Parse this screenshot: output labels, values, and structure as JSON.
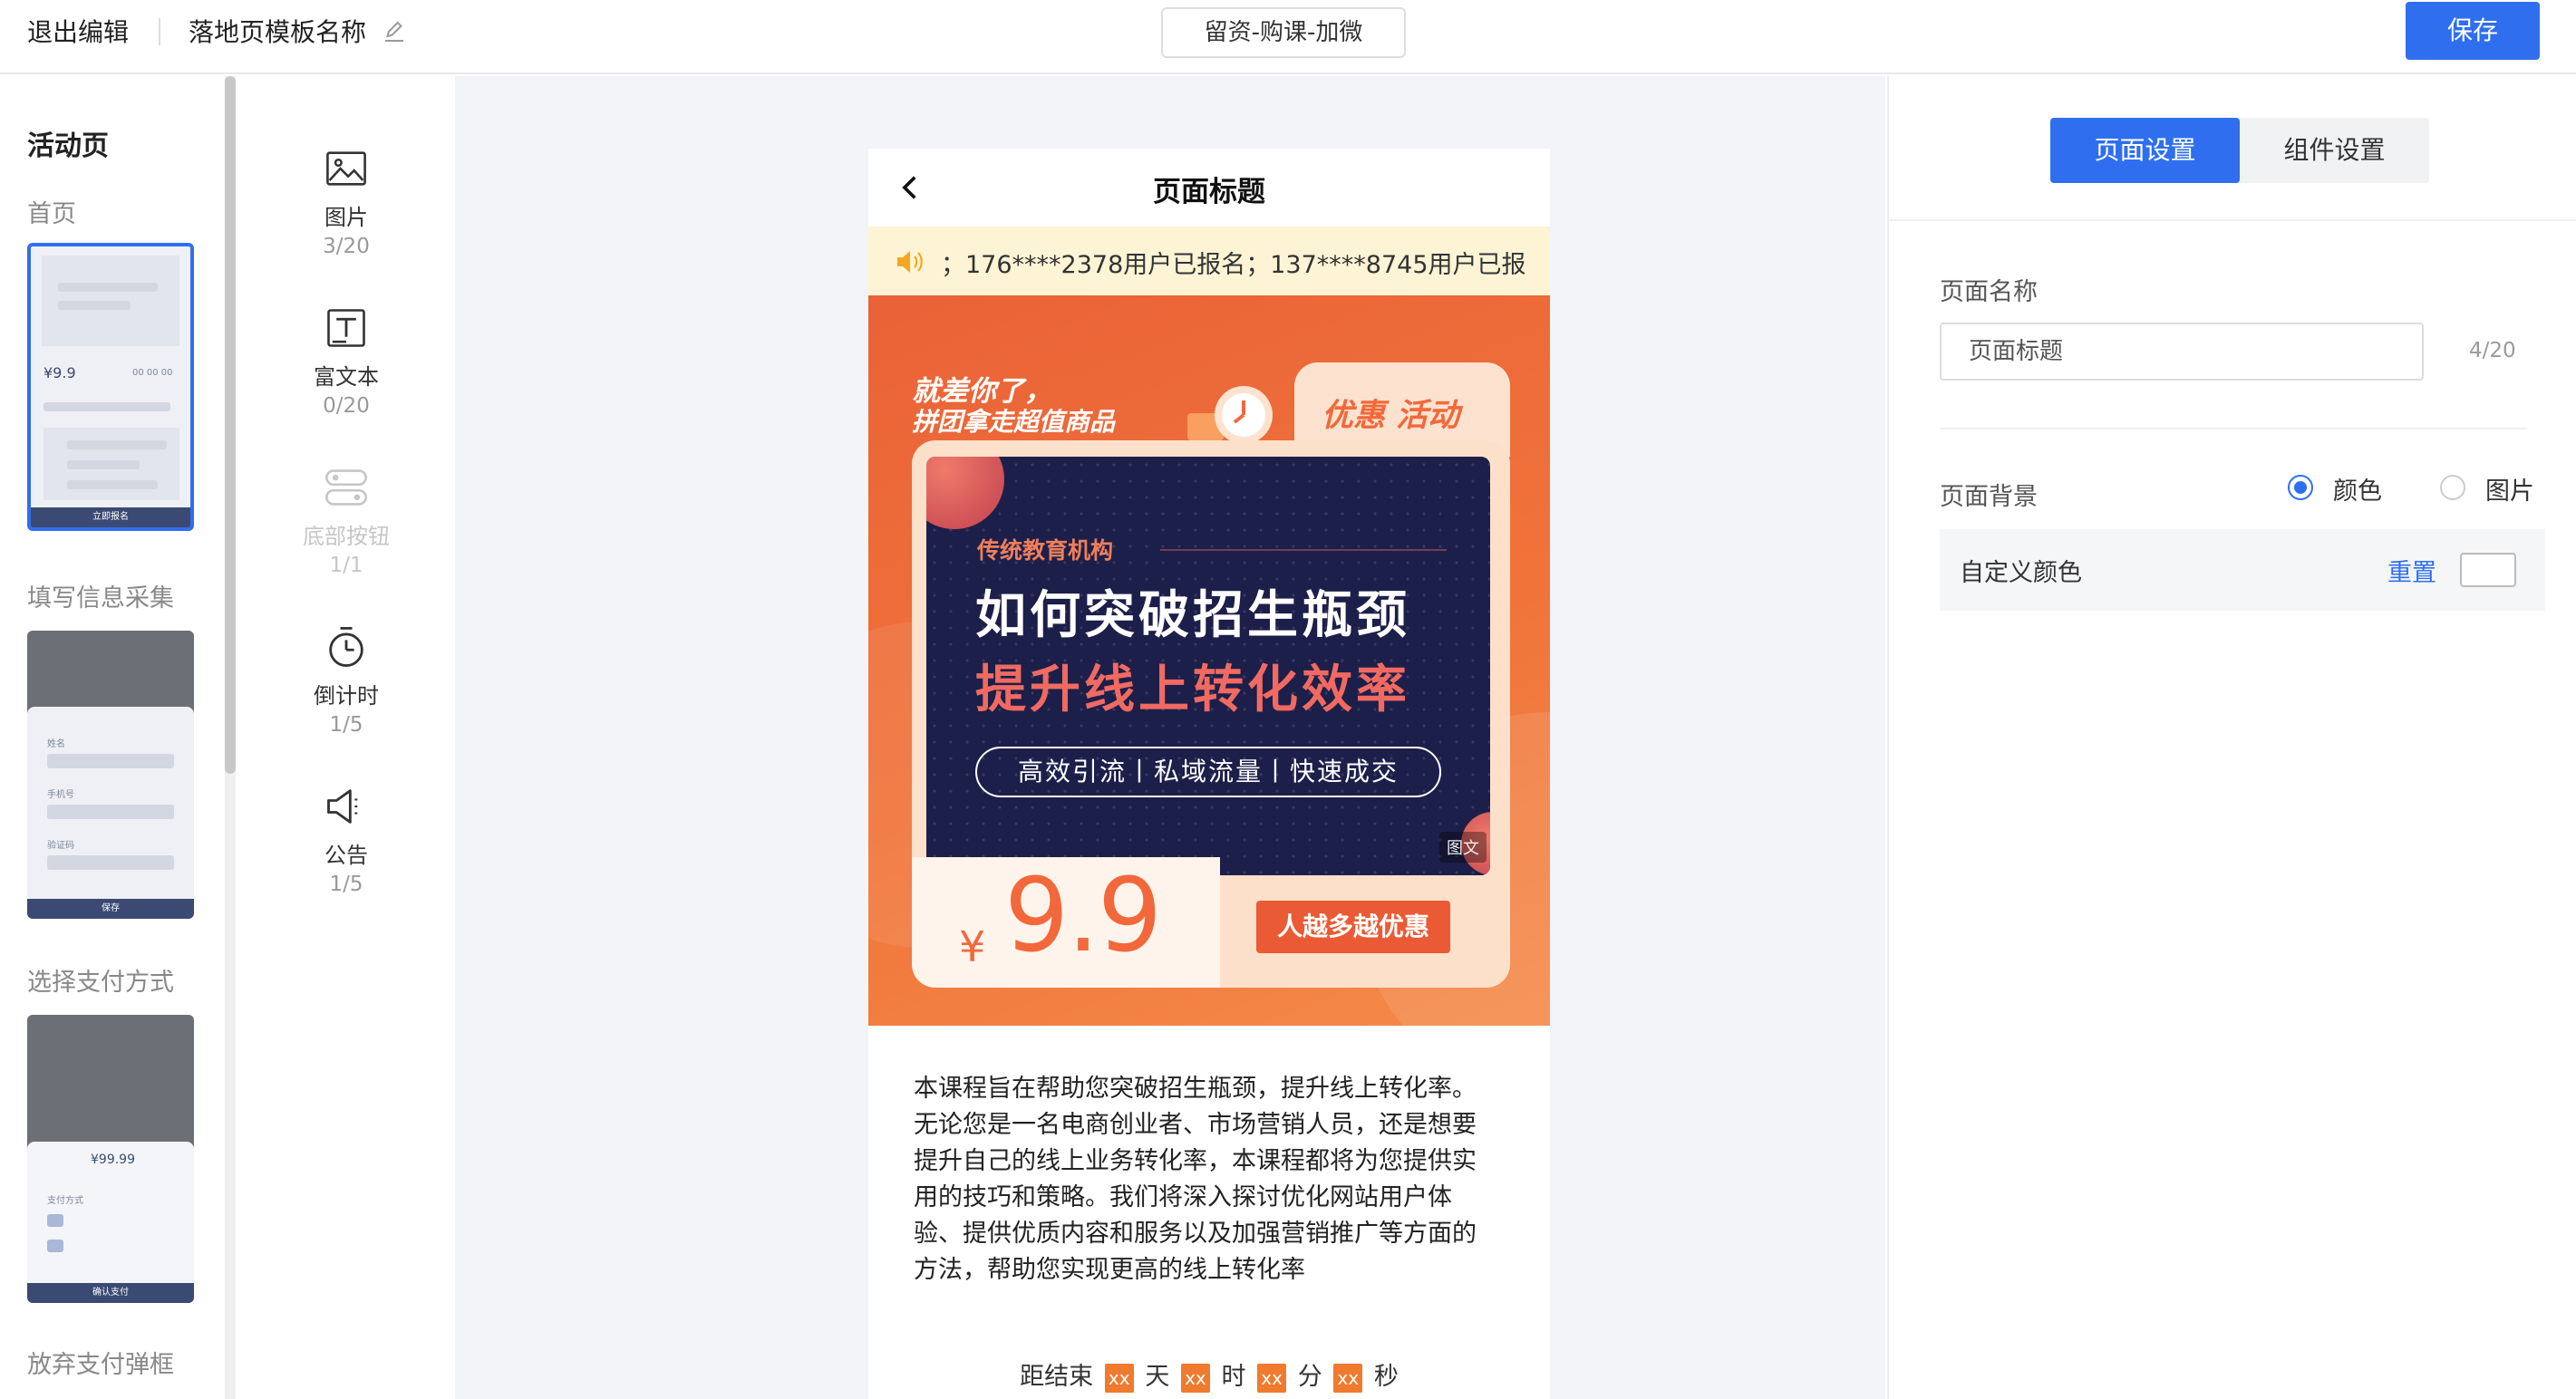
{
  "topbar": {
    "exit_label": "退出编辑",
    "template_name": "落地页模板名称",
    "mode_label": "留资-购课-加微",
    "save_label": "保存"
  },
  "pages": {
    "title": "活动页",
    "items": [
      {
        "label": "首页",
        "preview_price": "¥9.9",
        "preview_timer": "00 00 00",
        "preview_button": "立即报名"
      },
      {
        "label": "填写信息采集",
        "preview_fields": [
          "姓名",
          "手机号",
          "验证码"
        ],
        "preview_button": "保存"
      },
      {
        "label": "选择支付方式",
        "preview_price": "¥99.99",
        "preview_section": "支付方式",
        "preview_button": "确认支付"
      },
      {
        "label": "放弃支付弹框"
      }
    ]
  },
  "components": [
    {
      "label": "图片",
      "count": "3/20",
      "icon": "image-icon",
      "enabled": true
    },
    {
      "label": "富文本",
      "count": "0/20",
      "icon": "richtext-icon",
      "enabled": true
    },
    {
      "label": "底部按钮",
      "count": "1/1",
      "icon": "toggle-buttons-icon",
      "enabled": false
    },
    {
      "label": "倒计时",
      "count": "1/5",
      "icon": "stopwatch-icon",
      "enabled": true
    },
    {
      "label": "公告",
      "count": "1/5",
      "icon": "megaphone-icon",
      "enabled": true
    }
  ],
  "phone": {
    "title": "页面标题",
    "notice": "；176****2378用户已报名；137****8745用户已报",
    "banner": {
      "slogan_line1": "就差你了，",
      "slogan_line2": "拼团拿走超值商品",
      "promo": "优惠 活动",
      "subtitle": "传统教育机构",
      "headline1": "如何突破招生瓶颈",
      "headline2": "提升线上转化效率",
      "pill": "高效引流丨私域流量丨快速成交",
      "tag": "图文",
      "currency": "¥",
      "price": "9.9",
      "cta": "人越多越优惠"
    },
    "description_lines": [
      "本课程旨在帮助您突破招生瓶颈，提升线上转化率。",
      "无论您是一名电商创业者、市场营销人员，还是想要",
      "提升自己的线上业务转化率，本课程都将为您提供实",
      "用的技巧和策略。我们将深入探讨优化网站用户体",
      "验、提供优质内容和服务以及加强营销推广等方面的",
      "方法，帮助您实现更高的线上转化率"
    ],
    "countdown": {
      "prefix": "距结束",
      "placeholder": "xx",
      "day": "天",
      "hour": "时",
      "minute": "分",
      "second": "秒"
    }
  },
  "settings": {
    "tab_page": "页面设置",
    "tab_component": "组件设置",
    "name_label": "页面名称",
    "name_value": "页面标题",
    "name_count": "4/20",
    "bg_label": "页面背景",
    "bg_option_color": "颜色",
    "bg_option_image": "图片",
    "bg_selected": "颜色",
    "custom_color_label": "自定义颜色",
    "reset_label": "重置",
    "custom_color_value": "#ffffff"
  },
  "colors": {
    "accent": "#2f6fef",
    "banner_orange": "#ea6238",
    "countdown_box": "#f07a2e",
    "notice_bg": "#fdf4d5"
  }
}
